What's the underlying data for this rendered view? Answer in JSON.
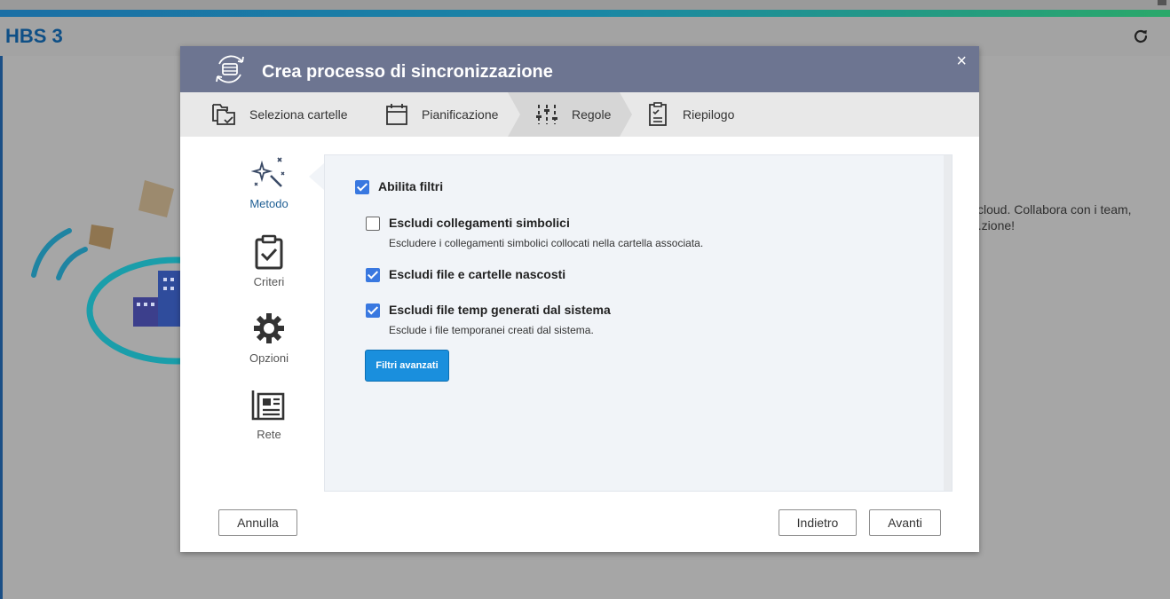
{
  "app": {
    "title": "HBS 3",
    "background_text": "i cloud. Collabora con i team, ...zione!"
  },
  "dialog": {
    "title": "Crea processo di sincronizzazione",
    "close_label": "×",
    "steps": [
      {
        "label": "Seleziona cartelle",
        "icon": "folder-check-icon"
      },
      {
        "label": "Pianificazione",
        "icon": "calendar-icon"
      },
      {
        "label": "Regole",
        "icon": "sliders-icon",
        "active": true
      },
      {
        "label": "Riepilogo",
        "icon": "clipboard-list-icon"
      }
    ],
    "nav": [
      {
        "label": "Metodo",
        "icon": "magic-wand-icon",
        "active": true
      },
      {
        "label": "Criteri",
        "icon": "clipboard-check-icon"
      },
      {
        "label": "Opzioni",
        "icon": "gear-icon"
      },
      {
        "label": "Rete",
        "icon": "newspaper-icon"
      }
    ],
    "filters": {
      "enable_label": "Abilita filtri",
      "enable_checked": true,
      "options": [
        {
          "label": "Escludi collegamenti simbolici",
          "desc": "Escludere i collegamenti simbolici collocati nella cartella associata.",
          "checked": false
        },
        {
          "label": "Escludi file e cartelle nascosti",
          "desc": "",
          "checked": true
        },
        {
          "label": "Escludi file temp generati dal sistema",
          "desc": "Esclude i file temporanei creati dal sistema.",
          "checked": true
        }
      ],
      "advanced_button": "Filtri avanzati"
    },
    "footer": {
      "cancel": "Annulla",
      "back": "Indietro",
      "next": "Avanti"
    }
  },
  "colors": {
    "header": "#6d7591",
    "accent": "#3978e0",
    "button_blue": "#1a8fdd"
  }
}
